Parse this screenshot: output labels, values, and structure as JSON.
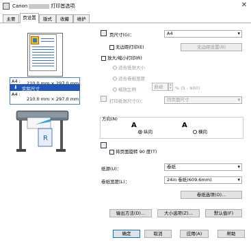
{
  "window": {
    "title_prefix": "Canon",
    "title_suffix": "打印首选项",
    "close_glyph": "✕"
  },
  "tabs": [
    {
      "label": "主要"
    },
    {
      "label": "页设置"
    },
    {
      "label": "版式"
    },
    {
      "label": "收藏"
    },
    {
      "label": "维护"
    }
  ],
  "left": {
    "size_top_name": "A4 :",
    "size_top_dims": "210.0 mm × 297.0 mm",
    "size_mid": "实际尺寸",
    "size_bot_name": "A4 :",
    "size_bot_dims": "210.0 mm × 297.0 mm"
  },
  "page_size": {
    "label": "页尺寸(G)：",
    "value": "A4"
  },
  "borderless": {
    "label": "无边距打印(E)",
    "button": "无边距设置(B)"
  },
  "scaled": {
    "label": "放大/缩小打印(R)",
    "fit_page": "适合纸张大小",
    "fit_roll": "适合卷纸宽度",
    "scale": "缩放比例",
    "scale_value": "自动",
    "scale_range": "% (5 - 600)"
  },
  "print_size": {
    "label": "打印纸张尺寸(I)：",
    "value": "同页面尺寸"
  },
  "orientation": {
    "label": "方向(N)",
    "portrait": "纵向",
    "landscape": "横向"
  },
  "rotate": {
    "label": "将页面旋转 90 度(T)"
  },
  "paper_source": {
    "label": "纸源(U)：",
    "value": "卷纸"
  },
  "roll_width": {
    "label": "卷纸宽度(L)：",
    "value": "24in 卷纸(609.6mm)"
  },
  "roll_options": {
    "label": "卷纸选项(O)..."
  },
  "bottom_buttons": {
    "output": "输出方法(D)...",
    "size_options": "大小选项(Z)...",
    "defaults": "默认值(F)"
  },
  "footer": {
    "ok": "确定",
    "cancel": "取消",
    "apply": "应用(A)",
    "help": "帮助"
  },
  "colors": {
    "accent": "#2156b8",
    "button": "#e1e1e1",
    "border": "#adadad"
  }
}
